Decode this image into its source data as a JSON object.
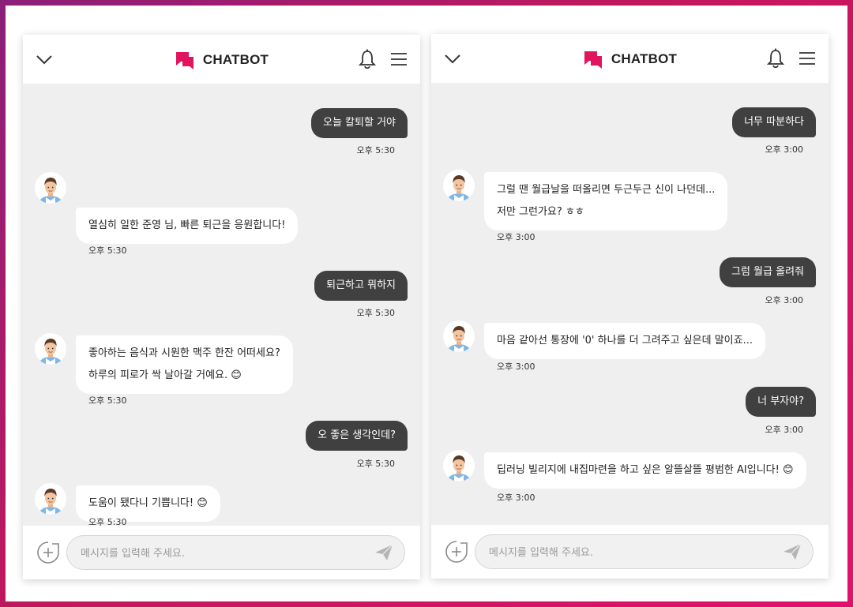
{
  "header": {
    "brand": "CHATBOT",
    "accent_color": "#e0145f",
    "icons": [
      "chevron-down-icon",
      "chat-bubble-icon",
      "bell-icon",
      "menu-icon"
    ]
  },
  "footer": {
    "placeholder": "메시지를 입력해 주세요.",
    "icons": [
      "plus-circle-icon",
      "send-icon"
    ]
  },
  "left_chat": {
    "messages": [
      {
        "sender": "user",
        "text": "오늘 칼퇴할 거야",
        "time": "오후 5:30"
      },
      {
        "sender": "bot",
        "lines": [
          "열심히 일한 준영 님, 빠른 퇴근을 응원합니다!"
        ],
        "time": "오후 5:30"
      },
      {
        "sender": "user",
        "text": "퇴근하고 뭐하지",
        "time": "오후 5:30"
      },
      {
        "sender": "bot",
        "lines": [
          "좋아하는 음식과 시원한 맥주 한잔 어떠세요?",
          "하루의 피로가 싹 날아갈 거예요. 😊"
        ],
        "time": "오후 5:30"
      },
      {
        "sender": "user",
        "text": "오 좋은 생각인데?",
        "time": "오후 5:30"
      },
      {
        "sender": "bot",
        "lines": [
          "도움이 됐다니 기쁩니다! 😊"
        ],
        "time": "오후 5:30"
      }
    ]
  },
  "right_chat": {
    "messages": [
      {
        "sender": "user",
        "text": "너무 따분하다",
        "time": "오후 3:00"
      },
      {
        "sender": "bot",
        "lines": [
          "그럴 땐 월급날을 떠올리면 두근두근 신이 나던데...",
          "저만 그런가요? ㅎㅎ"
        ],
        "time": "오후 3:00"
      },
      {
        "sender": "user",
        "text": "그럼 월급 올려줘",
        "time": "오후 3:00"
      },
      {
        "sender": "bot",
        "lines": [
          "마음 같아선 통장에 '0' 하나를 더 그려주고 싶은데 말이죠..."
        ],
        "time": "오후 3:00"
      },
      {
        "sender": "user",
        "text": "너 부자야?",
        "time": "오후 3:00"
      },
      {
        "sender": "bot",
        "lines": [
          "딥러닝 빌리지에 내집마련을 하고 싶은 알뜰살뜰 평범한 AI입니다! 😊"
        ],
        "time": "오후 3:00"
      }
    ]
  }
}
